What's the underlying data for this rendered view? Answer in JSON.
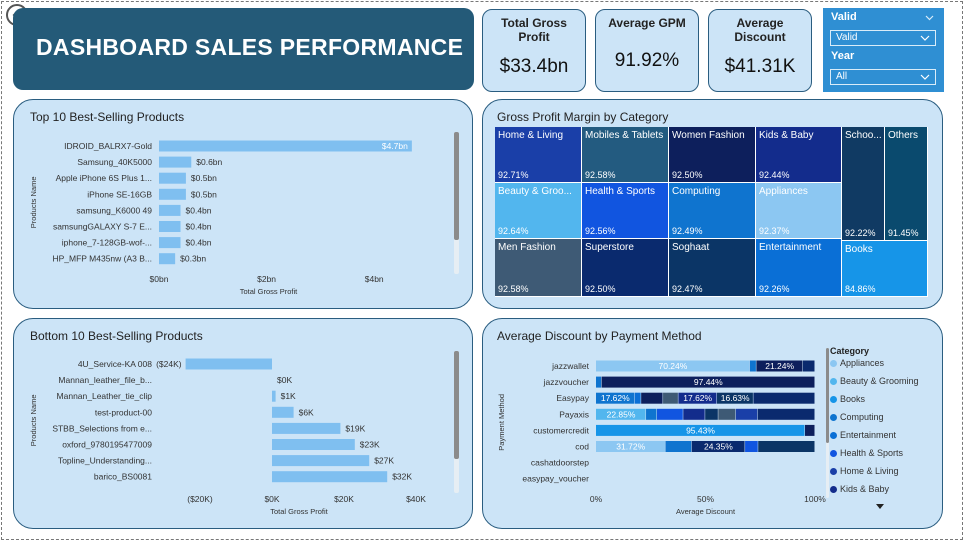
{
  "header": {
    "title": "DASHBOARD SALES PERFORMANCE"
  },
  "kpis": [
    {
      "label": "Total Gross Profit",
      "value": "$33.4bn"
    },
    {
      "label": "Average GPM",
      "value": "91.92%"
    },
    {
      "label": "Average Discount",
      "value": "$41.31K"
    }
  ],
  "filters": {
    "valid_label": "Valid",
    "valid_value": "Valid",
    "year_label": "Year",
    "year_value": "All"
  },
  "colors": {
    "title_bg": "#245a78",
    "card_bg": "#cce4f7",
    "bar": "#7fbff0",
    "slicer_bg": "#2f8fd3"
  },
  "chart_data": [
    {
      "type": "bar",
      "orientation": "horizontal",
      "title": "Top 10 Best-Selling Products",
      "xlabel": "Total Gross Profit",
      "ylabel": "Products Name",
      "categories": [
        "IDROID_BALRX7-Gold",
        "Samsung_40K5000",
        "Apple iPhone 6S Plus 1...",
        "iPhone SE-16GB",
        "samsung_K6000 49",
        "samsungGALAXY S-7 E...",
        "iphone_7-128GB-wof-...",
        "HP_MFP M435nw (A3 B..."
      ],
      "values": [
        4.7,
        0.6,
        0.5,
        0.5,
        0.4,
        0.4,
        0.4,
        0.3
      ],
      "value_labels": [
        "$4.7bn",
        "$0.6bn",
        "$0.5bn",
        "$0.5bn",
        "$0.4bn",
        "$0.4bn",
        "$0.4bn",
        "$0.3bn"
      ],
      "xlim": [
        0,
        5
      ],
      "xticks": [
        0,
        2,
        4
      ],
      "xtick_labels": [
        "$0bn",
        "$2bn",
        "$4bn"
      ]
    },
    {
      "type": "bar",
      "orientation": "horizontal",
      "title": "Bottom 10 Best-Selling Products",
      "xlabel": "Total Gross Profit",
      "ylabel": "Products Name",
      "categories": [
        "4U_Service-KA 008",
        "Mannan_leather_file_b...",
        "Mannan_Leather_tie_clip",
        "test-product-00",
        "STBB_Selections from e...",
        "oxford_9780195477009",
        "Topline_Understanding...",
        "barico_BS0081"
      ],
      "values": [
        -24,
        0,
        1,
        6,
        19,
        23,
        27,
        32
      ],
      "value_labels": [
        "($24K)",
        "$0K",
        "$1K",
        "$6K",
        "$19K",
        "$23K",
        "$27K",
        "$32K"
      ],
      "xlim": [
        -30,
        45
      ],
      "xticks": [
        -20,
        0,
        20,
        40
      ],
      "xtick_labels": [
        "($20K)",
        "$0K",
        "$20K",
        "$40K"
      ]
    },
    {
      "type": "heatmap",
      "subtype": "treemap",
      "title": "Gross Profit Margin by Category",
      "cells": [
        {
          "name": "Home & Living",
          "value": "92.71%",
          "color": "#1a3fa8"
        },
        {
          "name": "Mobiles & Tablets",
          "value": "92.58%",
          "color": "#235b80"
        },
        {
          "name": "Women Fashion",
          "value": "92.50%",
          "color": "#0d1f5c"
        },
        {
          "name": "Kids & Baby",
          "value": "92.44%",
          "color": "#132c8c"
        },
        {
          "name": "Schoo...",
          "value": "92.22%",
          "color": "#103a63"
        },
        {
          "name": "Others",
          "value": "91.45%",
          "color": "#0a4a6e"
        },
        {
          "name": "Beauty & Groo...",
          "value": "92.64%",
          "color": "#52b6ee"
        },
        {
          "name": "Health & Sports",
          "value": "92.56%",
          "color": "#1155e0"
        },
        {
          "name": "Computing",
          "value": "92.49%",
          "color": "#0f74cf"
        },
        {
          "name": "Appliances",
          "value": "92.37%",
          "color": "#8cc7f2"
        },
        {
          "name": "Men Fashion",
          "value": "92.58%",
          "color": "#3e5a75"
        },
        {
          "name": "Superstore",
          "value": "92.50%",
          "color": "#0a2a6e"
        },
        {
          "name": "Soghaat",
          "value": "92.47%",
          "color": "#0b3566"
        },
        {
          "name": "Entertainment",
          "value": "92.26%",
          "color": "#0a6fd6"
        },
        {
          "name": "Books",
          "value": "84.86%",
          "color": "#1695e8"
        }
      ]
    },
    {
      "type": "bar",
      "subtype": "100% stacked horizontal",
      "title": "Average Discount by Payment Method",
      "xlabel": "Average Discount",
      "ylabel": "Payment Method",
      "categories": [
        "jazzwallet",
        "jazzvoucher",
        "Easypay",
        "Payaxis",
        "customercredit",
        "cod",
        "cashatdoorstep",
        "easypay_voucher"
      ],
      "xlim": [
        0,
        100
      ],
      "xtick_labels": [
        "0%",
        "50%",
        "100%"
      ],
      "legend_title": "Category",
      "legend_items": [
        "Appliances",
        "Beauty & Grooming",
        "Books",
        "Computing",
        "Entertainment",
        "Health & Sports",
        "Home & Living",
        "Kids & Baby"
      ],
      "legend_colors": [
        "#8cc7f2",
        "#52b6ee",
        "#1695e8",
        "#0f74cf",
        "#0a6fd6",
        "#1155e0",
        "#1a3fa8",
        "#132c8c"
      ],
      "rows": [
        {
          "segments": [
            {
              "value": 70.24,
              "label": "70.24%",
              "color": "#8cc7f2"
            },
            {
              "value": 3,
              "color": "#0f74cf"
            },
            {
              "value": 21.24,
              "label": "21.24%",
              "color": "#0d1f5c"
            },
            {
              "value": 5.52,
              "color": "#0a2a6e"
            }
          ]
        },
        {
          "segments": [
            {
              "value": 2.56,
              "color": "#0f74cf"
            },
            {
              "value": 97.44,
              "label": "97.44%",
              "color": "#0d1f5c"
            }
          ]
        },
        {
          "segments": [
            {
              "value": 17.62,
              "label": "17.62%",
              "color": "#0f74cf"
            },
            {
              "value": 3,
              "color": "#0a6fd6"
            },
            {
              "value": 10,
              "color": "#0d1f5c"
            },
            {
              "value": 7,
              "color": "#3e5a75"
            },
            {
              "value": 17.62,
              "label": "17.62%",
              "color": "#132c8c"
            },
            {
              "value": 16.63,
              "label": "16.63%",
              "color": "#0b3566"
            },
            {
              "value": 28.13,
              "color": "#0a2a6e"
            }
          ]
        },
        {
          "segments": [
            {
              "value": 22.85,
              "label": "22.85%",
              "color": "#52b6ee"
            },
            {
              "value": 5,
              "color": "#0f74cf"
            },
            {
              "value": 12,
              "color": "#1155e0"
            },
            {
              "value": 10,
              "color": "#132c8c"
            },
            {
              "value": 6,
              "color": "#0b3566"
            },
            {
              "value": 8,
              "color": "#3e5a75"
            },
            {
              "value": 10,
              "color": "#1a3fa8"
            },
            {
              "value": 26.15,
              "color": "#0a2a6e"
            }
          ]
        },
        {
          "segments": [
            {
              "value": 95.43,
              "label": "95.43%",
              "color": "#1695e8"
            },
            {
              "value": 4.57,
              "color": "#0d1f5c"
            }
          ]
        },
        {
          "segments": [
            {
              "value": 31.72,
              "label": "31.72%",
              "color": "#8cc7f2"
            },
            {
              "value": 12,
              "color": "#0f74cf"
            },
            {
              "value": 24.35,
              "label": "24.35%",
              "color": "#0a2a6e"
            },
            {
              "value": 6,
              "color": "#1155e0"
            },
            {
              "value": 25.93,
              "color": "#0b3566"
            }
          ]
        },
        {
          "segments": []
        },
        {
          "segments": []
        }
      ]
    }
  ]
}
